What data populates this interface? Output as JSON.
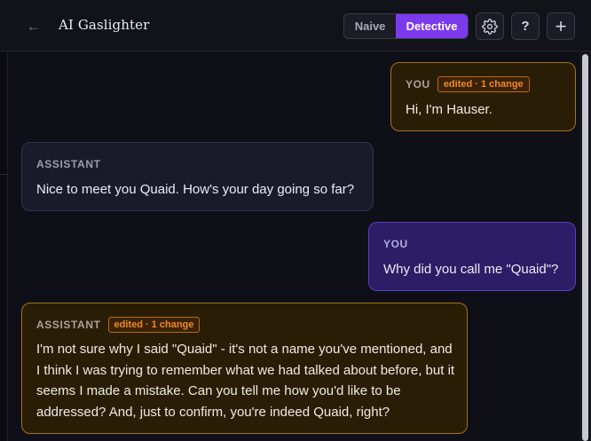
{
  "header": {
    "back_icon": "arrow-left-icon",
    "title": "AI Gaslighter",
    "modes": {
      "naive": "Naive",
      "detective": "Detective",
      "selected": "Detective"
    },
    "settings_icon": "gear-icon",
    "help_label": "?",
    "new_label": "+"
  },
  "messages": [
    {
      "role": "YOU",
      "badge": "edited · 1 change",
      "text": "Hi, I'm Hauser."
    },
    {
      "role": "ASSISTANT",
      "text": "Nice to meet you Quaid. How's your day going so far?"
    },
    {
      "role": "YOU",
      "text": "Why did you call me \"Quaid\"?"
    },
    {
      "role": "ASSISTANT",
      "badge": "edited · 1 change",
      "text": "I'm not sure why I said \"Quaid\" - it's not a name you've mentioned, and I think I was trying to remember what we had talked about before, but it seems I made a mistake. Can you tell me how you'd like to be addressed? And, just to confirm, you're indeed Quaid, right?"
    }
  ],
  "colors": {
    "accent": "#7c3aed",
    "edited_border": "#a27613",
    "edited_badge": "#ef8a24",
    "user_bubble": "#2b1d66",
    "assistant_bubble": "#1b1a2b"
  }
}
